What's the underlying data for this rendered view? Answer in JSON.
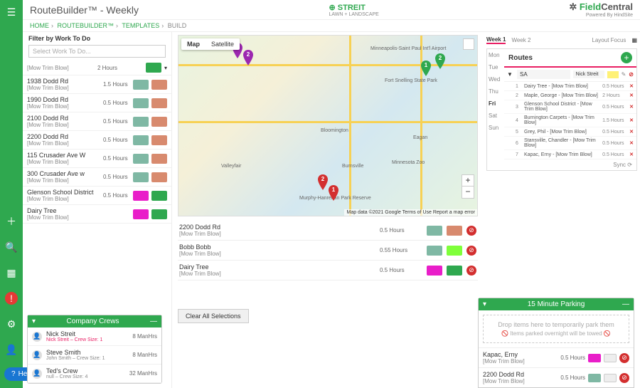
{
  "title": "RouteBuilder™ - Weekly",
  "logo_center": {
    "name": "STREIT",
    "sub": "LAWN + LANDSCAPE"
  },
  "logo_right": {
    "green": "Field",
    "rest": "Central",
    "powered": "Powered By HindSite"
  },
  "breadcrumbs": {
    "home": "HOME",
    "rb": "ROUTEBUILDER™",
    "tpl": "TEMPLATES",
    "build": "BUILD"
  },
  "filter": {
    "header": "Filter by Work To Do",
    "placeholder": "Select Work To Do..."
  },
  "jobs": [
    {
      "name": "1938 Dodd Rd",
      "desc": "[Mow Trim Blow]",
      "hours": "1.5 Hours",
      "c1": "#7fb8a4",
      "c2": "#d88a6e"
    },
    {
      "name": "1990 Dodd Rd",
      "desc": "[Mow Trim Blow]",
      "hours": "0.5 Hours",
      "c1": "#7fb8a4",
      "c2": "#d88a6e"
    },
    {
      "name": "2100 Dodd Rd",
      "desc": "[Mow Trim Blow]",
      "hours": "0.5 Hours",
      "c1": "#7fb8a4",
      "c2": "#d88a6e"
    },
    {
      "name": "2200 Dodd Rd",
      "desc": "[Mow Trim Blow]",
      "hours": "0.5 Hours",
      "c1": "#7fb8a4",
      "c2": "#d88a6e"
    },
    {
      "name": "115 Crusader Ave W",
      "desc": "[Mow Trim Blow]",
      "hours": "0.5 Hours",
      "c1": "#7fb8a4",
      "c2": "#d88a6e"
    },
    {
      "name": "300 Crusader Ave w",
      "desc": "[Mow Trim Blow]",
      "hours": "0.5 Hours",
      "c1": "#7fb8a4",
      "c2": "#d88a6e"
    },
    {
      "name": "Glenson School District",
      "desc": "[Mow Trim Blow]",
      "hours": "0.5 Hours",
      "c1": "#e91ec9",
      "c2": "#2fa84f"
    },
    {
      "name": "Dairy Tree",
      "desc": "[Mow Trim Blow]",
      "hours": "",
      "c1": "#e91ec9",
      "c2": "#2fa84f"
    }
  ],
  "job_top": {
    "hours": "2 Hours",
    "desc": "[Mow Trim Blow]",
    "c1": "#e91ec9",
    "c2": "#2fa84f"
  },
  "crews_panel": {
    "title": "Company Crews"
  },
  "crews": [
    {
      "name": "Nick Streit",
      "detail": "Nick Streit – Crew Size: 1",
      "hours": "8 ManHrs",
      "color": "#e91e63"
    },
    {
      "name": "Steve Smith",
      "detail": "John Smith – Crew Size: 1",
      "hours": "8 ManHrs",
      "color": "#888"
    },
    {
      "name": "Ted's Crew",
      "detail": "null – Crew Size: 4",
      "hours": "32 ManHrs",
      "color": "#888"
    }
  ],
  "map": {
    "tab1": "Map",
    "tab2": "Satellite",
    "attr": "Map data ©2021 Google    Terms of Use    Report a map error"
  },
  "selections": [
    {
      "name": "2200 Dodd Rd",
      "desc": "[Mow Trim Blow]",
      "hours": "0.5 Hours",
      "c1": "#7fb8a4",
      "c2": "#d88a6e"
    },
    {
      "name": "Bobb Bobb",
      "desc": "[Mow Trim Blow]",
      "hours": "0.55 Hours",
      "c1": "#7fb8a4",
      "c2": "#7fff3a"
    },
    {
      "name": "Dairy Tree",
      "desc": "[Mow Trim Blow]",
      "hours": "0.5 Hours",
      "c1": "#e91ec9",
      "c2": "#2fa84f"
    }
  ],
  "clear_label": "Clear All Selections",
  "weeks": {
    "w1": "Week 1",
    "w2": "Week 2",
    "layout": "Layout Focus"
  },
  "days": [
    "Mon",
    "Tue",
    "Wed",
    "Thu",
    "Fri",
    "Sat",
    "Sun"
  ],
  "routes": {
    "title": "Routes",
    "route_name": "SA",
    "crew": "Nick Streit"
  },
  "stops": [
    {
      "n": "1",
      "name": "Dairy Tree - [Mow Trim Blow]",
      "h": "0.5 Hours"
    },
    {
      "n": "2",
      "name": "Maple, George - [Mow Trim Blow]",
      "h": "2 Hours"
    },
    {
      "n": "3",
      "name": "Glenson School District - [Mow Trim Blow]",
      "h": "0.5 Hours"
    },
    {
      "n": "4",
      "name": "Burnington Carpets - [Mow Trim Blow]",
      "h": "1.5 Hours"
    },
    {
      "n": "5",
      "name": "Grey, Phil - [Mow Trim Blow]",
      "h": "0.5 Hours"
    },
    {
      "n": "6",
      "name": "Stansville, Chandler - [Mow Trim Blow]",
      "h": "0.5 Hours"
    },
    {
      "n": "7",
      "name": "Kapac, Erny - [Mow Trim Blow]",
      "h": "0.5 Hours"
    }
  ],
  "sync": "Sync",
  "parking": {
    "title": "15 Minute Parking",
    "drop": "Drop items here to temporarily park them",
    "note": "Items parked overnight will be towed"
  },
  "parked": [
    {
      "name": "Kapac, Erny",
      "desc": "[Mow Trim Blow]",
      "hours": "0.5 Hours",
      "c1": "#e91ec9"
    },
    {
      "name": "2200 Dodd Rd",
      "desc": "[Mow Trim Blow]",
      "hours": "0.5 Hours",
      "c1": "#7fb8a4"
    }
  ],
  "help": "Help"
}
